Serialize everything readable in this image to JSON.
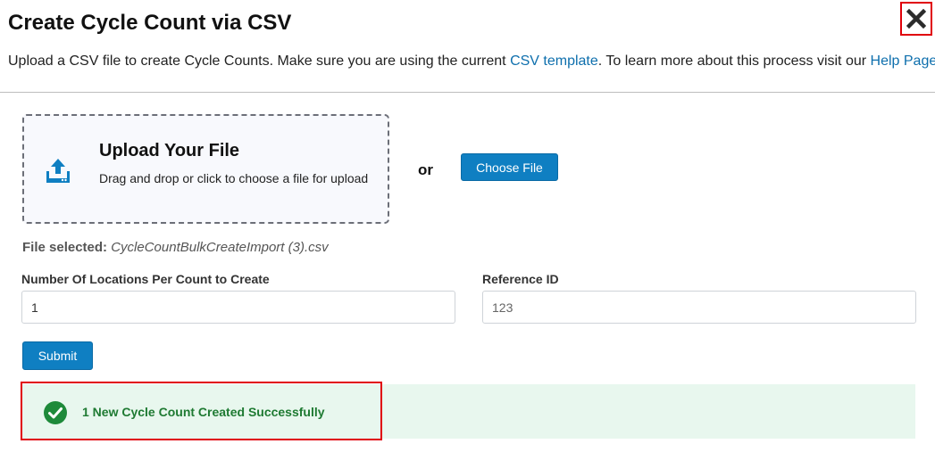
{
  "header": {
    "title": "Create Cycle Count via CSV",
    "close_icon": "close-x-icon"
  },
  "description": {
    "text_before": "Upload a CSV file to create Cycle Counts. Make sure you are using the current ",
    "template_link": "CSV template",
    "text_middle": ". To learn more about this process visit our ",
    "help_link": "Help Page",
    "text_after": "."
  },
  "upload": {
    "icon": "upload-tray-icon",
    "title": "Upload Your File",
    "subtitle": "Drag and drop or click to choose a file for upload",
    "or_label": "or",
    "choose_button": "Choose File"
  },
  "file_selected": {
    "label": "File selected:",
    "filename": "CycleCountBulkCreateImport (3).csv"
  },
  "form": {
    "locations_label": "Number Of Locations Per Count to Create",
    "locations_value": "1",
    "reference_label": "Reference ID",
    "reference_placeholder": "123",
    "submit_label": "Submit"
  },
  "status": {
    "icon": "check-circle-icon",
    "message": "1 New Cycle Count Created Successfully"
  },
  "colors": {
    "accent": "#0f7fc2",
    "link": "#0e6fad",
    "success_bg": "#e8f7ee",
    "success_text": "#1e7a32",
    "highlight": "#e0000a"
  }
}
